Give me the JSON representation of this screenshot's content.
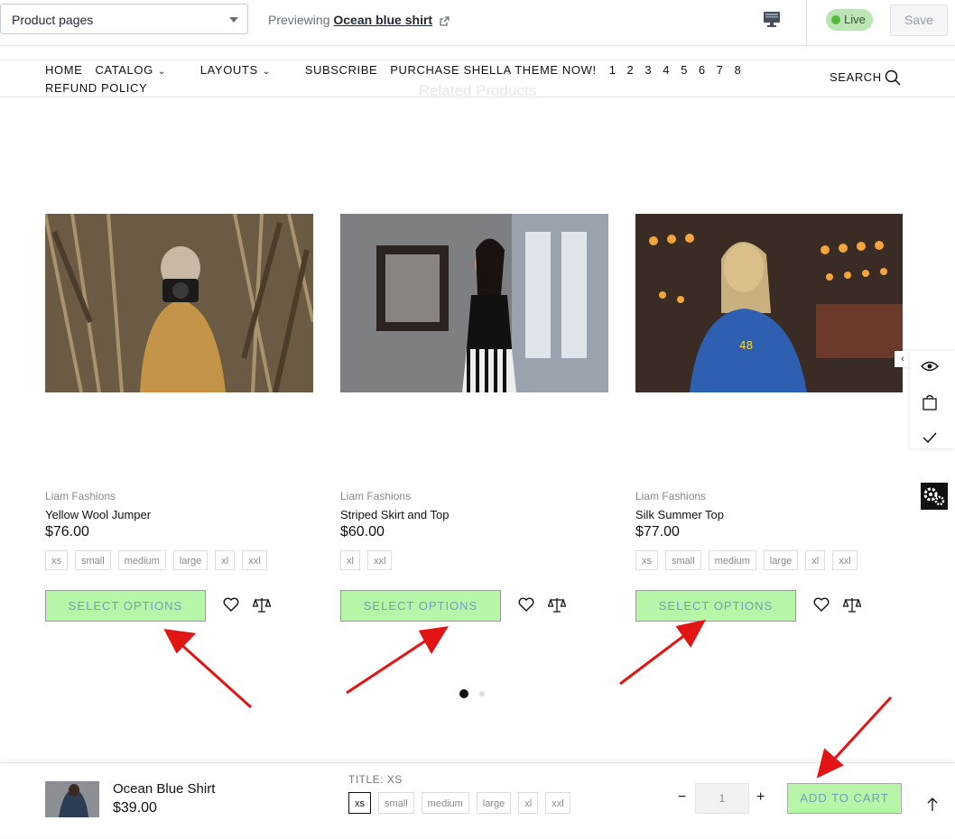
{
  "topbar": {
    "page_select": "Product pages",
    "preview_prefix": "Previewing",
    "preview_link": "Ocean blue shirt",
    "live_label": "Live",
    "save_label": "Save"
  },
  "nav": {
    "items": [
      "HOME",
      "CATALOG",
      "LAYOUTS",
      "SUBSCRIBE",
      "PURCHASE SHELLA THEME NOW!",
      "1",
      "2",
      "3",
      "4",
      "5",
      "6",
      "7",
      "8"
    ],
    "row2": "REFUND POLICY",
    "search_label": "SEARCH"
  },
  "section_title": "Related Products",
  "products": [
    {
      "vendor": "Liam Fashions",
      "title": "Yellow Wool Jumper",
      "price": "$76.00",
      "sizes": [
        "xs",
        "small",
        "medium",
        "large",
        "xl",
        "xxl"
      ],
      "button": "SELECT OPTIONS"
    },
    {
      "vendor": "Liam Fashions",
      "title": "Striped Skirt and Top",
      "price": "$60.00",
      "sizes": [
        "xl",
        "xxl"
      ],
      "button": "SELECT OPTIONS"
    },
    {
      "vendor": "Liam Fashions",
      "title": "Silk Summer Top",
      "price": "$77.00",
      "sizes": [
        "xs",
        "small",
        "medium",
        "large",
        "xl",
        "xxl"
      ],
      "button": "SELECT OPTIONS"
    }
  ],
  "sticky": {
    "title": "Ocean Blue Shirt",
    "price": "$39.00",
    "variant_title": "TITLE: XS",
    "sizes": [
      "xs",
      "small",
      "medium",
      "large",
      "xl",
      "xxl"
    ],
    "selected_size": "xs",
    "minus": "−",
    "qty": "1",
    "plus": "+",
    "add_to_cart": "ADD TO CART"
  },
  "colors": {
    "button_bg": "#b7f5a9",
    "button_text": "#6e9fbf",
    "arrow": "#e31414",
    "live_bg": "#bbe5b3"
  },
  "icons": [
    "chevron-down-icon",
    "external-link-icon",
    "desktop-icon",
    "search-icon",
    "heart-icon",
    "compare-icon",
    "eye-icon",
    "bag-icon",
    "check-icon",
    "gears-icon",
    "arrow-up-icon"
  ]
}
